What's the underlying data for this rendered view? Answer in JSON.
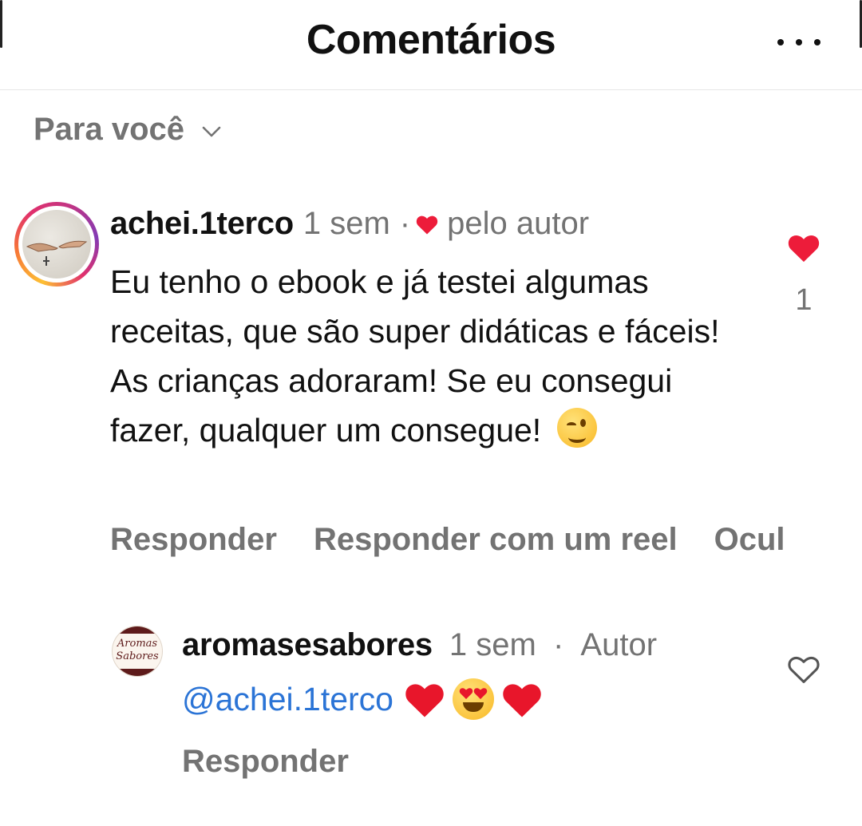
{
  "header": {
    "title": "Comentários",
    "menu_icon": "more-horizontal-icon"
  },
  "filter": {
    "label": "Para você",
    "icon": "chevron-down-icon"
  },
  "comments": [
    {
      "username": "achei.1terco",
      "time": "1 sem",
      "separator": "·",
      "liked_by_author_label": "pelo autor",
      "text": "Eu tenho o ebook e já testei algumas receitas, que são super didáticas e fáceis! As crianças adoraram! Se eu consegui fazer, qualquer um consegue!",
      "emoji": "winking-face",
      "like_count": "1",
      "liked": true,
      "actions": [
        "Responder",
        "Responder com um reel",
        "Ocul"
      ],
      "avatar_has_story_ring": true
    }
  ],
  "reply": {
    "username": "aromasesabores",
    "time": "1 sem",
    "separator": "·",
    "role": "Autor",
    "mention": "@achei.1terco",
    "emojis": [
      "red-heart",
      "smiling-face-with-heart-eyes",
      "red-heart"
    ],
    "liked": false,
    "action": "Responder",
    "avatar_logo_text": [
      "Aromas",
      "Sabores"
    ]
  },
  "colors": {
    "like_red": "#ed1c3a",
    "muted_text": "#737373",
    "mention_blue": "#2b74d6",
    "logo_maroon": "#5e1b1b"
  }
}
